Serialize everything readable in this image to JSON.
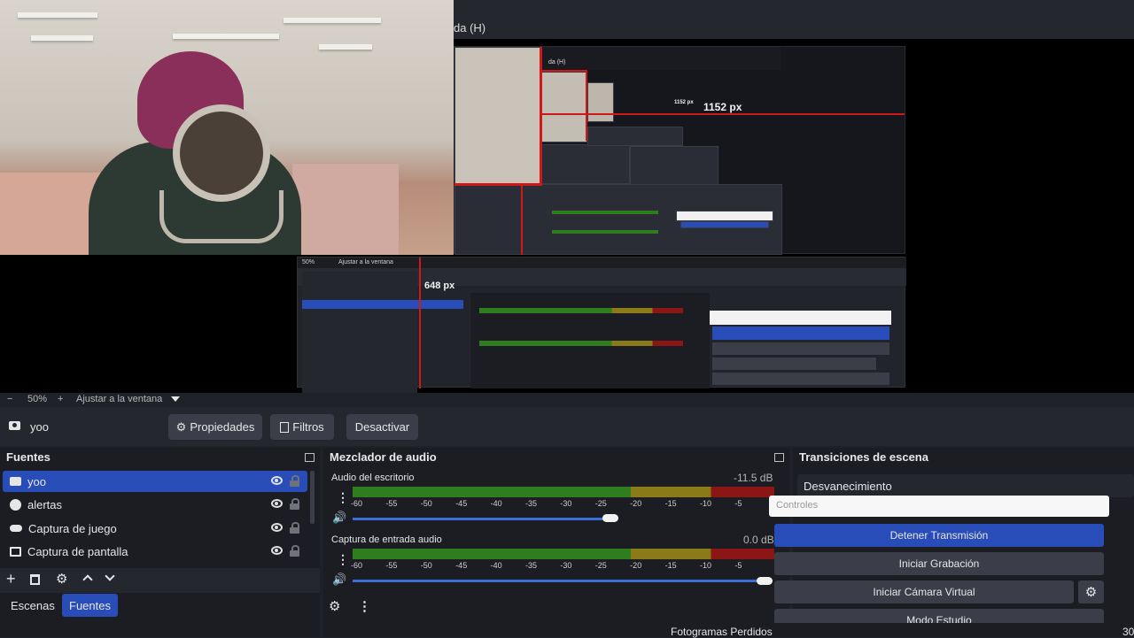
{
  "preview": {
    "window_title_fragment": "da (H)",
    "nested_title_fragment": "da (H)",
    "px_label_large": "1152 px",
    "px_label_small": "1152 px",
    "px_label_648": "648 px",
    "nested_zoom": "50%",
    "nested_fit": "Ajustar a la ventana"
  },
  "zoombar": {
    "minus": "−",
    "zoom": "50%",
    "plus": "+",
    "fit_label": "Ajustar a la ventana"
  },
  "source_toolbar": {
    "source_name": "yoo",
    "properties_label": "Propiedades",
    "filters_label": "Filtros",
    "deactivate_label": "Desactivar"
  },
  "sources_dock": {
    "title": "Fuentes",
    "items": [
      {
        "label": "yoo",
        "icon": "camera-icon",
        "selected": true
      },
      {
        "label": "alertas",
        "icon": "globe-icon",
        "selected": false
      },
      {
        "label": "Captura de juego",
        "icon": "gamepad-icon",
        "selected": false
      },
      {
        "label": "Captura de pantalla",
        "icon": "monitor-icon",
        "selected": false
      }
    ],
    "tabs": [
      {
        "label": "Escenas",
        "active": false
      },
      {
        "label": "Fuentes",
        "active": true
      }
    ]
  },
  "mixer_dock": {
    "title": "Mezclador de audio",
    "ticks": [
      "-60",
      "-55",
      "-50",
      "-45",
      "-40",
      "-35",
      "-30",
      "-25",
      "-20",
      "-15",
      "-10",
      "-5"
    ],
    "channels": [
      {
        "name": "Audio del escritorio",
        "db": "-11.5 dB",
        "volume": 0.92
      },
      {
        "name": "Captura de entrada audio",
        "db": "0.0 dB",
        "volume": 1.0
      }
    ]
  },
  "transitions_dock": {
    "title": "Transiciones de escena",
    "transition": "Desvanecimiento"
  },
  "controls_dock": {
    "title": "Controles",
    "stop_stream": "Detener Transmisión",
    "start_recording": "Iniciar Grabación",
    "start_virtual_cam": "Iniciar Cámara Virtual",
    "studio_mode": "Modo Estudio"
  },
  "status": {
    "frames_label": "Fotogramas Perdidos",
    "fps": "30"
  },
  "colors": {
    "accent": "#284cb8",
    "meter_green": "#2f7d1f",
    "meter_yellow": "#8a7a18",
    "meter_red": "#8c1515"
  }
}
